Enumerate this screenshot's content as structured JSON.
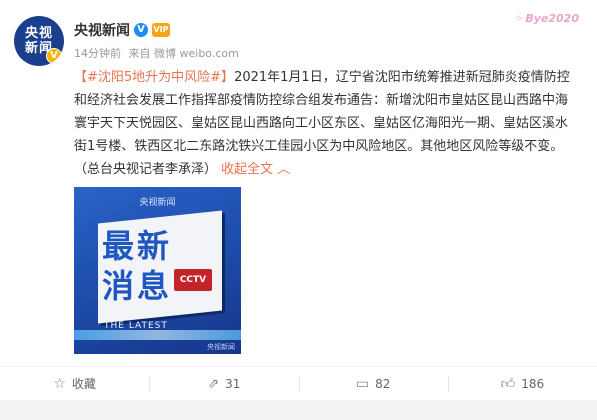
{
  "user": {
    "name": "央视新闻",
    "avatar_line1": "央视",
    "avatar_line2": "新闻",
    "avatar_badge": "V",
    "verified_icon": "V",
    "vip_icon": "VIP"
  },
  "meta": {
    "time": "14分钟前",
    "source": "来自 微博 weibo.com"
  },
  "decoration": {
    "text": "Bye2020"
  },
  "post": {
    "topic": "【#沈阳5地升为中风险#】",
    "body": "2021年1月1日，辽宁省沈阳市统筹推进新冠肺炎疫情防控和经济社会发展工作指挥部疫情防控综合组发布通告：新增沈阳市皇姑区昆山西路中海寰宇天下天悦园区、皇姑区昆山西路向工小区东区、皇姑区亿海阳光一期、皇姑区溪水街1号楼、铁西区北二东路沈铁兴工佳园小区为中风险地区。其他地区风险等级不变。（总台央视记者李承泽）",
    "expand": "收起全文 ︿"
  },
  "image": {
    "logo": "央视新闻",
    "line1": "最新",
    "line2": "消息",
    "cctv": "CCTV",
    "latest": "THE LATEST",
    "watermark": "央视新闻"
  },
  "actions": {
    "favorite": {
      "icon": "star-icon",
      "label": "收藏"
    },
    "repost": {
      "icon": "repost-icon",
      "count": "31"
    },
    "comment": {
      "icon": "comment-icon",
      "count": "82"
    },
    "like": {
      "icon": "thumbs-up-icon",
      "count": "186"
    }
  },
  "colors": {
    "link": "#eb7350",
    "avatar_bg": "#1b3f8f",
    "image_bg": "#2a63c8"
  }
}
